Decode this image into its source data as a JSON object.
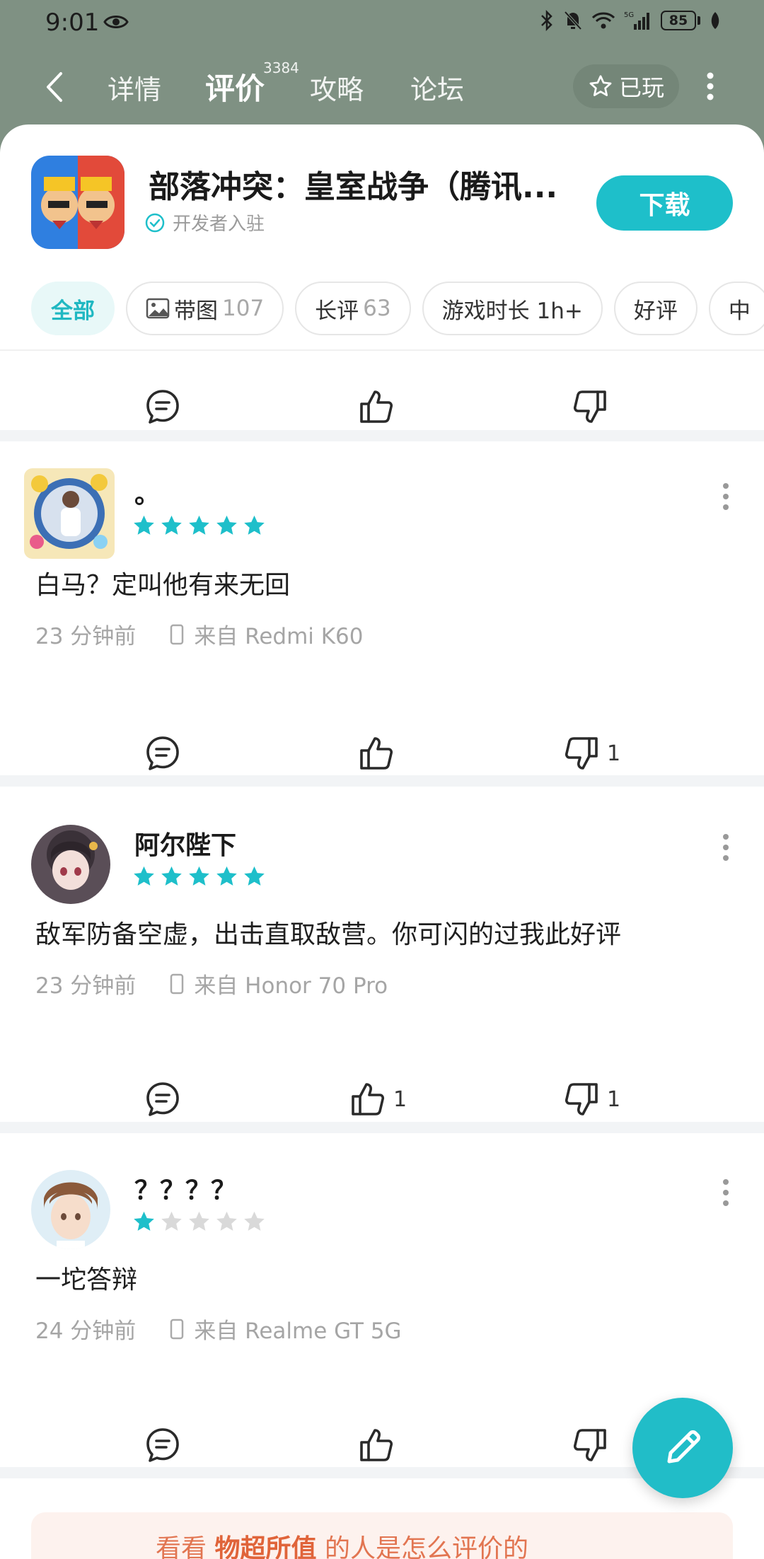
{
  "status": {
    "time": "9:01",
    "battery": "85",
    "network": "5G"
  },
  "nav": {
    "tabs": [
      {
        "label": "详情"
      },
      {
        "label": "评价"
      },
      {
        "label": "攻略"
      },
      {
        "label": "论坛"
      }
    ],
    "active_tab": "评价",
    "review_count": "3384",
    "played_label": "已玩"
  },
  "game": {
    "title": "部落冲突：皇室战争（腾讯...",
    "developer_badge": "开发者入驻",
    "download_label": "下载"
  },
  "filters": [
    {
      "label": "全部",
      "count": ""
    },
    {
      "label": "带图",
      "count": "107"
    },
    {
      "label": "长评",
      "count": "63"
    },
    {
      "label": "游戏时长 1h+",
      "count": ""
    },
    {
      "label": "好评",
      "count": ""
    },
    {
      "label": "中",
      "count": ""
    }
  ],
  "reviews": [
    {
      "username": "。",
      "rating": 5,
      "text": "白马？定叫他有来无回",
      "time": "23 分钟前",
      "device": "来自 Redmi K60",
      "likes": "",
      "dislikes": "1"
    },
    {
      "username": "阿尔陛下",
      "rating": 5,
      "text": "敌军防备空虚，出击直取敌营。你可闪的过我此好评",
      "time": "23 分钟前",
      "device": "来自 Honor 70 Pro",
      "likes": "1",
      "dislikes": "1"
    },
    {
      "username": "？？？？",
      "rating": 1,
      "text": "一坨答辩",
      "time": "24 分钟前",
      "device": "来自 Realme GT 5G",
      "likes": "",
      "dislikes": ""
    }
  ],
  "promo": {
    "prefix": "看看",
    "highlight": "物超所值",
    "suffix": "的人是怎么评价的"
  },
  "colors": {
    "accent": "#1ebfca",
    "header_bg": "#7f9183",
    "star_on": "#1ebfca",
    "star_off": "#d9d9d9"
  }
}
